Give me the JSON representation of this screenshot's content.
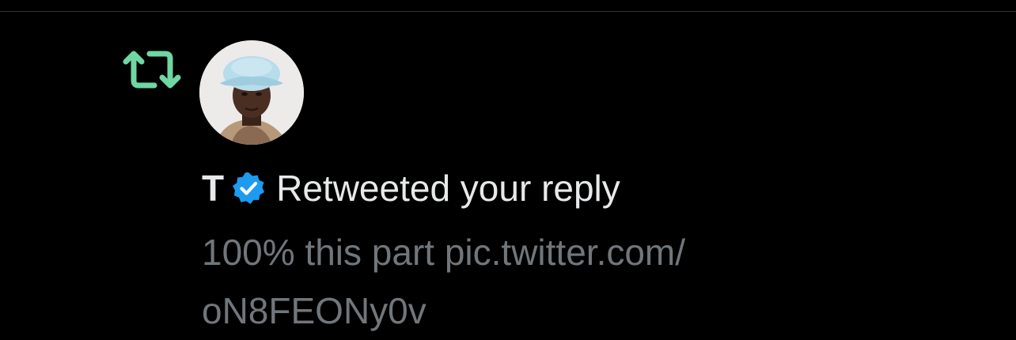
{
  "icons": {
    "retweet": "retweet-icon",
    "verified": "verified-badge-icon"
  },
  "colors": {
    "retweet_green": "#6fd6a4",
    "verified_blue": "#1d9bf0",
    "name_text": "#e7e9ea",
    "secondary_text": "#71767b",
    "background": "#000000"
  },
  "notification": {
    "user_name": "T",
    "action_text": "Retweeted your reply",
    "tweet_text_line1": "100% this part pic.twitter.com/",
    "tweet_text_line2": "oN8FEONy0v"
  }
}
